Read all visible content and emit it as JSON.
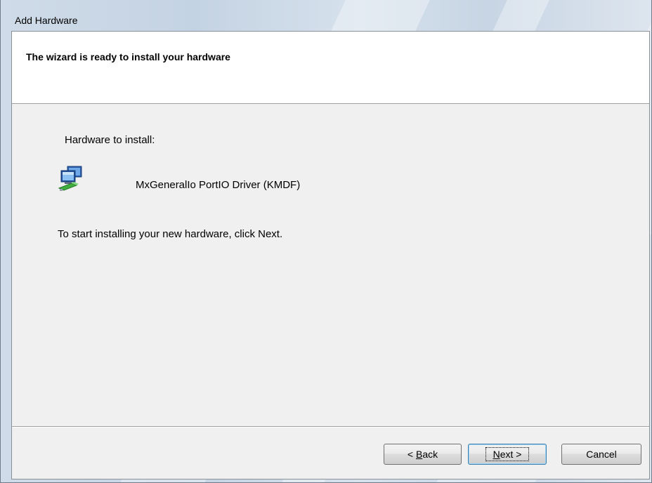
{
  "window": {
    "title": "Add Hardware"
  },
  "header": {
    "title": "The wizard is ready to install your hardware"
  },
  "content": {
    "hardware_label": "Hardware to install:",
    "device_name": "MxGeneralIo PortIO Driver (KMDF)",
    "device_icon": "hardware-device-icon",
    "instruction": "To start installing your new hardware, click Next."
  },
  "buttons": {
    "back": {
      "prefix": "< ",
      "mnemonic": "B",
      "rest": "ack"
    },
    "next": {
      "mnemonic": "N",
      "rest": "ext >"
    },
    "cancel": "Cancel"
  }
}
